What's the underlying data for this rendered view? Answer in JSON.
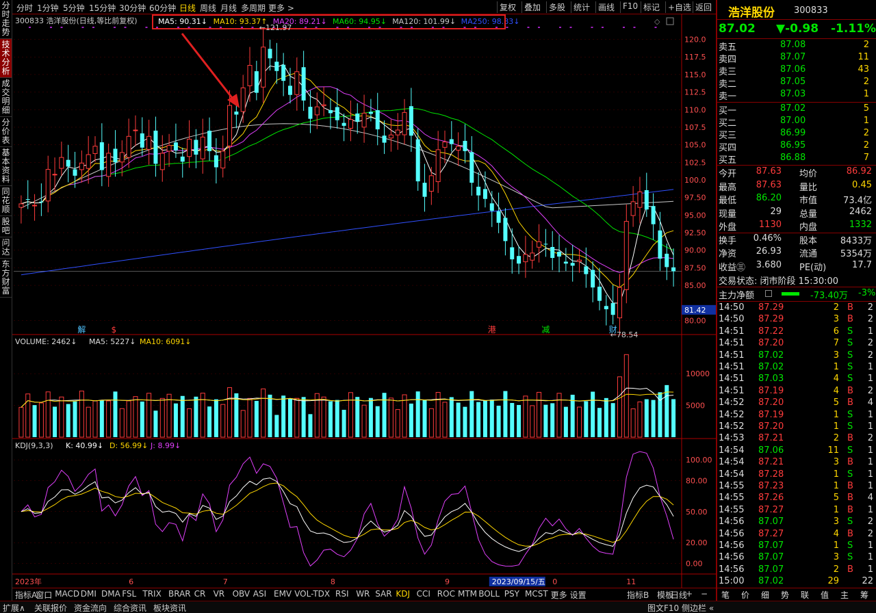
{
  "left_tabs": [
    "分时走势",
    "技术分析",
    "成交明细",
    "分价表",
    "基本资料",
    "同花顺",
    "股吧",
    "问达",
    "东方财富"
  ],
  "left_tab_active": 1,
  "topbar": {
    "left_items": [
      "分时",
      "1分钟",
      "5分钟",
      "15分钟",
      "30分钟",
      "60分钟",
      "日线",
      "周线",
      "月线",
      "多周期",
      "更多 >"
    ],
    "selected": "日线",
    "right_items": [
      "复权",
      "叠加",
      "多股",
      "统计",
      "画线",
      "F10",
      "标记",
      "+自选",
      "返回"
    ]
  },
  "info": {
    "stock_label": "300833 浩洋股份(日线,等比前复权)",
    "ma_items": [
      {
        "text": "MA5: 90.31",
        "arrow": "↓",
        "color": "#ffffff"
      },
      {
        "text": "MA10: 93.37",
        "arrow": "↑",
        "color": "#ffd700"
      },
      {
        "text": "MA20: 89.21",
        "arrow": "↓",
        "color": "#e040fb"
      },
      {
        "text": "MA60: 94.95",
        "arrow": "↓",
        "color": "#00e600"
      },
      {
        "text": "MA120: 101.99",
        "arrow": "↓",
        "color": "#c8c8c8"
      },
      {
        "text": "MA250: 98.83",
        "arrow": "↓",
        "color": "#3050ff"
      }
    ]
  },
  "price_axis": {
    "ticks": [
      "120.0",
      "117.5",
      "115.0",
      "112.5",
      "110.0",
      "107.5",
      "105.0",
      "102.5",
      "100.0",
      "97.50",
      "95.00",
      "92.50",
      "90.00",
      "87.50",
      "85.00",
      "80.00"
    ],
    "values": [
      120,
      117.5,
      115,
      112.5,
      110,
      107.5,
      105,
      102.5,
      100,
      97.5,
      95,
      92.5,
      90,
      87.5,
      85,
      80
    ],
    "min": 78,
    "max": 122
  },
  "hover_price_label": "81.42",
  "extremes": {
    "high": "121.97",
    "low": "78.54"
  },
  "event_marks": [
    {
      "label": "解",
      "color": "#4fc3ff",
      "col": 9
    },
    {
      "label": "$",
      "color": "#ff3c3c",
      "col": 14
    },
    {
      "label": "港",
      "color": "#ff3c3c",
      "col": 70
    },
    {
      "label": "减",
      "color": "#00e600",
      "col": 78
    },
    {
      "label": "财",
      "color": "#4fc3ff",
      "col": 88
    }
  ],
  "volume": {
    "label": "VOLUME: 2462",
    "ma5": "MA5: 5227",
    "ma10": "MA10: 6091",
    "ticks": [
      "10000",
      "5000"
    ]
  },
  "kdj": {
    "label": "KDJ(9,3,3)",
    "k": "K: 40.99",
    "d": "D: 56.99",
    "j": "J: 8.99",
    "ticks": [
      "100.00",
      "80.00",
      "50.00",
      "20.00",
      "0.00"
    ]
  },
  "x_labels": [
    {
      "text": "2023年",
      "col": 0
    },
    {
      "text": "6",
      "col": 16
    },
    {
      "text": "7",
      "col": 30
    },
    {
      "text": "8",
      "col": 46
    },
    {
      "text": "9",
      "col": 63
    },
    {
      "text": "2023/09/15/五",
      "col": 70,
      "hl": true
    },
    {
      "text": "0",
      "col": 79
    },
    {
      "text": "11",
      "col": 90
    }
  ],
  "bottom_tabs": [
    "指标A",
    "窗口",
    "MACD",
    "DMI",
    "DMA",
    "FSL",
    "TRIX",
    "BRAR",
    "CR",
    "VR",
    "OBV",
    "ASI",
    "EMV",
    "VOL-TDX",
    "RSI",
    "WR",
    "SAR",
    "KDJ",
    "CCI",
    "ROC",
    "MTM",
    "BOLL",
    "PSY",
    "MCST",
    "更多",
    "设置"
  ],
  "bottom_active": "KDJ",
  "bottom_right": [
    "指标B",
    "模板",
    "日线",
    "+",
    "−"
  ],
  "statusbar": {
    "left": [
      "扩展∧",
      "关联报价",
      "资金流向",
      "综合资讯",
      "板块资讯"
    ],
    "right": [
      "图文F10",
      "侧边栏 «"
    ]
  },
  "panel": {
    "name": "浩洋股份",
    "code": "300833",
    "price": "87.02",
    "change": "▼-0.98",
    "pct": "-1.11%",
    "asks": [
      [
        "卖五",
        "87.08",
        "2"
      ],
      [
        "卖四",
        "87.07",
        "11"
      ],
      [
        "卖三",
        "87.06",
        "43"
      ],
      [
        "卖二",
        "87.05",
        "2"
      ],
      [
        "卖一",
        "87.03",
        "1"
      ]
    ],
    "bids": [
      [
        "买一",
        "87.02",
        "5"
      ],
      [
        "买二",
        "87.00",
        "1"
      ],
      [
        "买三",
        "86.99",
        "2"
      ],
      [
        "买四",
        "86.95",
        "2"
      ],
      [
        "买五",
        "86.88",
        "7"
      ]
    ],
    "stats": [
      [
        "今开",
        "87.63",
        "red",
        "均价",
        "86.92",
        "red"
      ],
      [
        "最高",
        "87.63",
        "red",
        "量比",
        "0.45",
        "yel"
      ],
      [
        "最低",
        "86.20",
        "grn",
        "市值",
        "73.4亿",
        "wht"
      ],
      [
        "现量",
        "29",
        "wht",
        "总量",
        "2462",
        "wht"
      ],
      [
        "外盘",
        "1130",
        "red",
        "内盘",
        "1332",
        "grn"
      ],
      [
        "换手",
        "0.46%",
        "wht",
        "股本",
        "8433万",
        "wht"
      ],
      [
        "净资",
        "26.93",
        "wht",
        "流通",
        "5354万",
        "wht"
      ],
      [
        "收益㊂",
        "3.680",
        "wht",
        "PE(动)",
        "17.7",
        "wht"
      ]
    ],
    "trade_status": "交易状态: 闭市阶段 15:30:00",
    "main_flow": {
      "label": "主力净额",
      "value": "-73.40万",
      "pct": "-3%"
    },
    "ticks": [
      [
        "14:50",
        "87.29",
        "2",
        "B",
        "2"
      ],
      [
        "14:50",
        "87.29",
        "3",
        "B",
        "2"
      ],
      [
        "14:51",
        "87.22",
        "6",
        "S",
        "1"
      ],
      [
        "14:51",
        "87.20",
        "7",
        "S",
        "2"
      ],
      [
        "14:51",
        "87.02",
        "3",
        "S",
        "2"
      ],
      [
        "14:51",
        "87.02",
        "1",
        "S",
        "1"
      ],
      [
        "14:51",
        "87.03",
        "4",
        "S",
        "1"
      ],
      [
        "14:51",
        "87.19",
        "4",
        "B",
        "2"
      ],
      [
        "14:52",
        "87.20",
        "5",
        "B",
        "4"
      ],
      [
        "14:52",
        "87.19",
        "1",
        "S",
        "1"
      ],
      [
        "14:52",
        "87.20",
        "1",
        "S",
        "1"
      ],
      [
        "14:53",
        "87.21",
        "2",
        "B",
        "2"
      ],
      [
        "14:54",
        "87.06",
        "11",
        "S",
        "1"
      ],
      [
        "14:54",
        "87.21",
        "3",
        "B",
        "1"
      ],
      [
        "14:54",
        "87.28",
        "1",
        "S",
        "1"
      ],
      [
        "14:55",
        "87.23",
        "1",
        "B",
        "1"
      ],
      [
        "14:55",
        "87.26",
        "5",
        "B",
        "4"
      ],
      [
        "14:55",
        "87.27",
        "1",
        "B",
        "1"
      ],
      [
        "14:56",
        "87.07",
        "3",
        "S",
        "2"
      ],
      [
        "14:56",
        "87.27",
        "4",
        "B",
        "2"
      ],
      [
        "14:56",
        "87.07",
        "1",
        "S",
        "1"
      ],
      [
        "14:56",
        "87.07",
        "3",
        "S",
        "1"
      ],
      [
        "14:56",
        "87.07",
        "2",
        "B",
        "1"
      ],
      [
        "15:00",
        "87.02",
        "29",
        "",
        "22"
      ]
    ],
    "bottom_tabs": [
      "笔",
      "价",
      "细",
      "势",
      "联",
      "值",
      "主",
      "筹"
    ]
  },
  "colors": {
    "up": "#ff3c3c",
    "down": "#54ffff",
    "ma5": "#ffffff",
    "ma10": "#ffd700",
    "ma20": "#e040fb",
    "ma60": "#00e600",
    "ma120": "#c8c8c8",
    "ma250": "#3050ff",
    "grid": "#550000"
  },
  "chart_data": {
    "type": "candlestick",
    "closes": [
      96.6,
      97.2,
      96.4,
      96.8,
      101.5,
      100.8,
      103.2,
      101.9,
      100.6,
      102.4,
      103.6,
      104.8,
      101.4,
      103.8,
      102.5,
      103.9,
      106.2,
      107.1,
      104.6,
      106.2,
      102.3,
      103.8,
      104.9,
      104.2,
      102.6,
      105.8,
      103.6,
      106.1,
      104.1,
      101.8,
      104.1,
      110.6,
      109.3,
      113.1,
      116.3,
      112.4,
      118.9,
      117.3,
      115.5,
      114.1,
      112.1,
      115.4,
      111.3,
      108.7,
      110.4,
      110.7,
      109.5,
      108.5,
      107.7,
      108.6,
      108.3,
      109.5,
      109.4,
      107.2,
      105.3,
      106.4,
      107.1,
      109.6,
      106.3,
      99.8,
      97.6,
      100.6,
      104.3,
      105.4,
      105.1,
      104.8,
      104.1,
      99.6,
      97.8,
      97.3,
      95.6,
      93.9,
      91.3,
      88.7,
      88.1,
      89.4,
      89.6,
      91.2,
      90.9,
      88.9,
      89.1,
      88.1,
      87.8,
      88.6,
      86.6,
      84.7,
      82.8,
      81.6,
      80.8,
      84.7,
      94.1,
      96.9,
      98.3,
      95.8,
      93.7,
      88.8,
      87.6,
      87.0
    ],
    "ma_last": {
      "ma5": 90.31,
      "ma10": 93.37,
      "ma20": 89.21,
      "ma60": 94.95,
      "ma120": 101.99,
      "ma250": 98.83
    }
  }
}
